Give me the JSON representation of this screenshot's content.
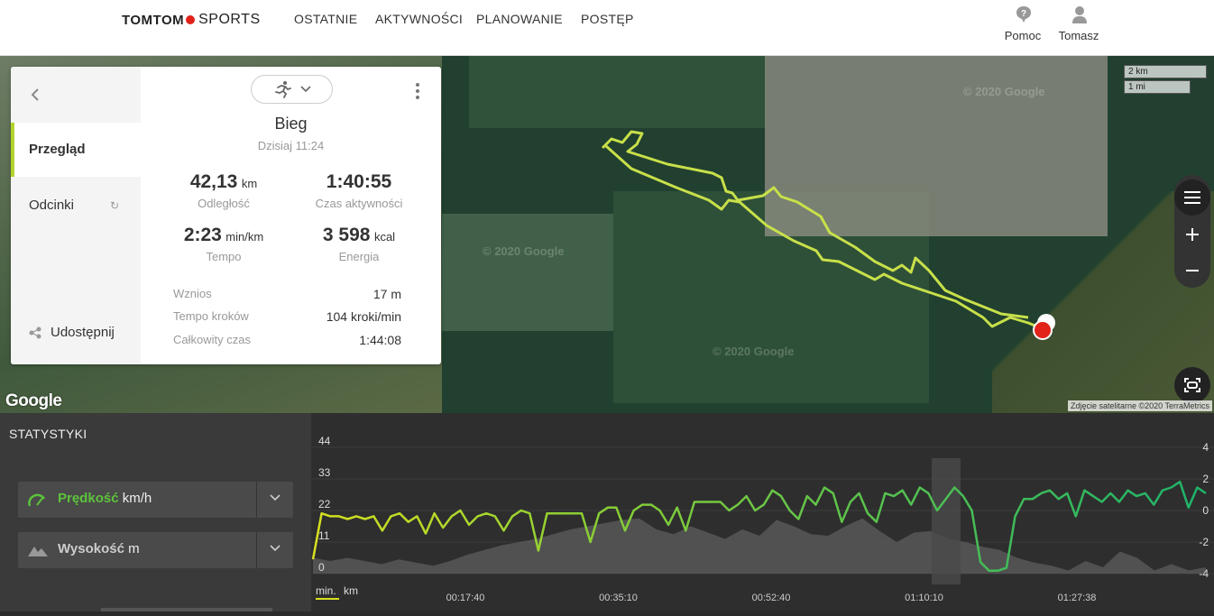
{
  "header": {
    "logo_brand": "TOMTOM",
    "logo_product": "SPORTS",
    "nav": [
      "OSTATNIE",
      "AKTYWNOŚCI",
      "PLANOWANIE",
      "POSTĘP"
    ],
    "help_label": "Pomoc",
    "user_label": "Tomasz"
  },
  "map": {
    "watermark": "© 2020 Google",
    "google_logo": "Google",
    "attribution": "Zdjęcie satelitarne ©2020 TerraMetrics",
    "scale_km": "2 km",
    "scale_mi": "1 mi",
    "track_color": "#c8e04a",
    "marker_color": "#e2231a"
  },
  "sidebar": {
    "items": [
      {
        "label": "Przegląd"
      },
      {
        "label": "Odcinki"
      }
    ],
    "share_label": "Udostępnij"
  },
  "activity": {
    "type": "Bieg",
    "date": "Dzisiaj 11:24",
    "distance": {
      "value": "42,13",
      "unit": "km",
      "label": "Odległość"
    },
    "active_time": {
      "value": "1:40:55",
      "label": "Czas aktywności"
    },
    "pace": {
      "value": "2:23",
      "unit": "min/km",
      "label": "Tempo"
    },
    "energy": {
      "value": "3 598",
      "unit": "kcal",
      "label": "Energia"
    },
    "details": [
      {
        "label": "Wznios",
        "value": "17 m"
      },
      {
        "label": "Tempo kroków",
        "value": "104 kroki/min"
      },
      {
        "label": "Całkowity czas",
        "value": "1:44:08"
      }
    ]
  },
  "stats": {
    "heading": "STATYSTYKI",
    "speed": {
      "label": "Prędkość",
      "unit": "km/h",
      "color": "#5cc33a"
    },
    "altitude": {
      "label": "Wysokość",
      "unit": "m",
      "color": "#cccccc"
    },
    "axis_mode_label": "min.",
    "axis_mode_alt": "km"
  },
  "chart_data": {
    "type": "line",
    "y_left_ticks": [
      "44",
      "33",
      "22",
      "11",
      "0"
    ],
    "y_right_ticks": [
      "4",
      "2",
      "0",
      "-2",
      "-4"
    ],
    "x_ticks": [
      "00:17:40",
      "00:35:10",
      "00:52:40",
      "01:10:10",
      "01:27:38"
    ],
    "ylim_left": [
      0,
      44
    ],
    "ylim_right": [
      -4,
      4
    ],
    "series": [
      {
        "name": "Prędkość",
        "values": [
          5,
          21,
          20,
          20,
          19,
          20,
          19,
          20,
          15,
          20,
          21,
          18,
          20,
          14,
          21,
          16,
          20,
          22,
          17,
          20,
          21,
          20,
          15,
          20,
          22,
          21,
          8,
          21,
          21,
          21,
          21,
          21,
          11,
          21,
          23,
          23,
          15,
          22,
          24,
          24,
          22,
          17,
          23,
          15,
          25,
          25,
          25,
          25,
          22,
          24,
          27,
          22,
          24,
          29,
          27,
          22,
          19,
          27,
          24,
          30,
          28,
          18,
          25,
          28,
          21,
          18,
          28,
          27,
          29,
          24,
          30,
          28,
          22,
          26,
          30,
          27,
          22,
          4,
          1,
          1,
          2,
          20,
          26,
          26,
          28,
          29,
          26,
          28,
          20,
          29,
          27,
          25,
          28,
          25,
          29,
          27,
          28,
          24,
          29,
          30,
          32,
          23,
          30,
          28
        ]
      },
      {
        "name": "Wysokość",
        "values": [
          -3,
          -3.2,
          -3,
          -3.2,
          -3.4,
          -3.1,
          -3.3,
          -3.5,
          -3.2,
          -2.8,
          -2.5,
          -2.2,
          -2,
          -1.8,
          -1.5,
          -1.2,
          -1,
          -0.8,
          -0.6,
          -0.5,
          -1.2,
          -1.5,
          -1,
          -1.4,
          -1.8,
          -1.2,
          -1.6,
          -0.6,
          -1,
          -1.5,
          -1.6,
          -1,
          -0.5,
          -1.3,
          -2,
          -1.4,
          -1.3,
          -1.8,
          -2,
          -2.3,
          -2.5,
          -3,
          -3.3,
          -3.5,
          -3.8,
          -3.2,
          -3.6,
          -2.6,
          -3,
          -3.8,
          -3.4,
          -3.8,
          -3.6
        ]
      }
    ]
  }
}
